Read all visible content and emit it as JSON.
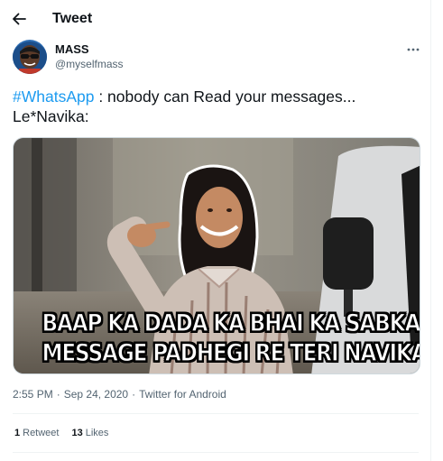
{
  "header": {
    "title": "Tweet",
    "back_icon": "arrow-left-icon"
  },
  "author": {
    "name": "MASS",
    "handle": "@myselfmass",
    "avatar_icon": "avatar-image"
  },
  "tweet": {
    "hashtag": "#WhatsApp",
    "line1_rest": " : nobody can Read your messages...",
    "line2": "Le*Navika:"
  },
  "media": {
    "caption_line1": "BAAP KA DADA KA BHAI KA SABKA",
    "caption_line2": "MESSAGE PADHEGI RE TERI NAVIKA"
  },
  "meta": {
    "time": "2:55 PM",
    "separator1": "·",
    "date": "Sep 24, 2020",
    "separator2": "·",
    "source": "Twitter for Android"
  },
  "stats": {
    "retweets_count": "1",
    "retweets_label": "Retweet",
    "likes_count": "13",
    "likes_label": "Likes"
  },
  "colors": {
    "link": "#1d9bf0",
    "secondary": "#536471",
    "text": "#0f1419"
  }
}
